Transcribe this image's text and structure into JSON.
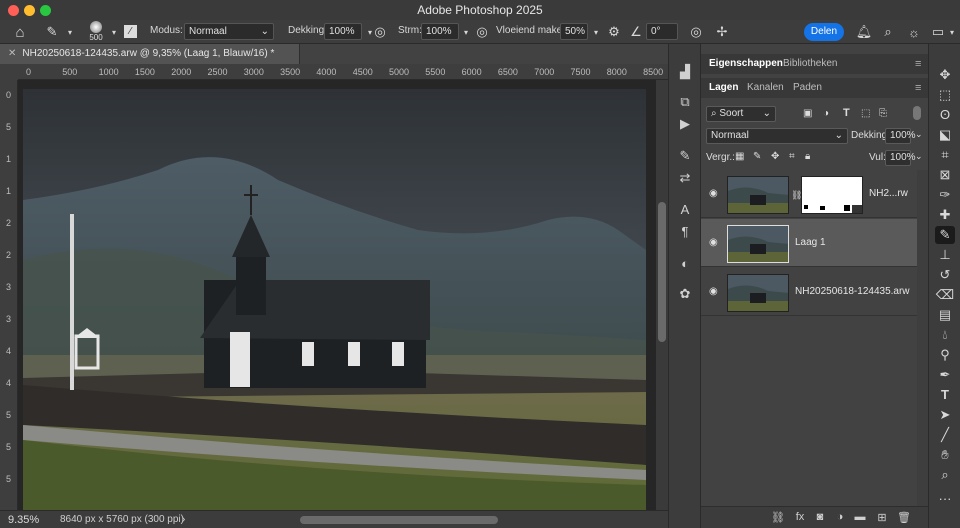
{
  "app": {
    "title": "Adobe Photoshop 2025"
  },
  "options": {
    "brush_size": "500",
    "mode_label": "Modus:",
    "mode_value": "Normaal",
    "opacity_label": "Dekking:",
    "opacity_value": "100%",
    "flow_label": "Strm:",
    "flow_value": "100%",
    "smoothing_label": "Vloeiend maken:",
    "smoothing_value": "50%",
    "angle_value": "0°",
    "share_label": "Delen"
  },
  "document": {
    "tab_title": "NH20250618-124435.arw @ 9,35% (Laag 1, Blauw/16) *",
    "zoom": "9.35%",
    "info": "8640 px x 5760 px (300 ppi)"
  },
  "ruler": {
    "h_ticks": [
      "0",
      "500",
      "1000",
      "1500",
      "2000",
      "2500",
      "3000",
      "3500",
      "4000",
      "4500",
      "5000",
      "5500",
      "6000",
      "6500",
      "7000",
      "7500",
      "8000",
      "8500"
    ],
    "v_ticks": [
      "0",
      "5",
      "1",
      "1",
      "2",
      "2",
      "3",
      "3",
      "4",
      "4",
      "5",
      "5",
      "5"
    ]
  },
  "panel": {
    "top_tabs": [
      "Eigenschappen",
      "Bibliotheken"
    ],
    "layer_tabs": [
      "Lagen",
      "Kanalen",
      "Paden"
    ],
    "filter_value": "Soort",
    "blend_mode": "Normaal",
    "opacity_label": "Dekking:",
    "opacity_value": "100%",
    "lock_label": "Vergr.:",
    "fill_label": "Vul:",
    "fill_value": "100%",
    "layers": [
      {
        "name": "NH2...rw",
        "has_mask": true
      },
      {
        "name": "Laag 1",
        "selected": true
      },
      {
        "name": "NH20250618-124435.arw"
      }
    ]
  },
  "colors": {
    "accent": "#1473e6",
    "selected_row": "#5a5a5a",
    "bg": "#535353"
  }
}
